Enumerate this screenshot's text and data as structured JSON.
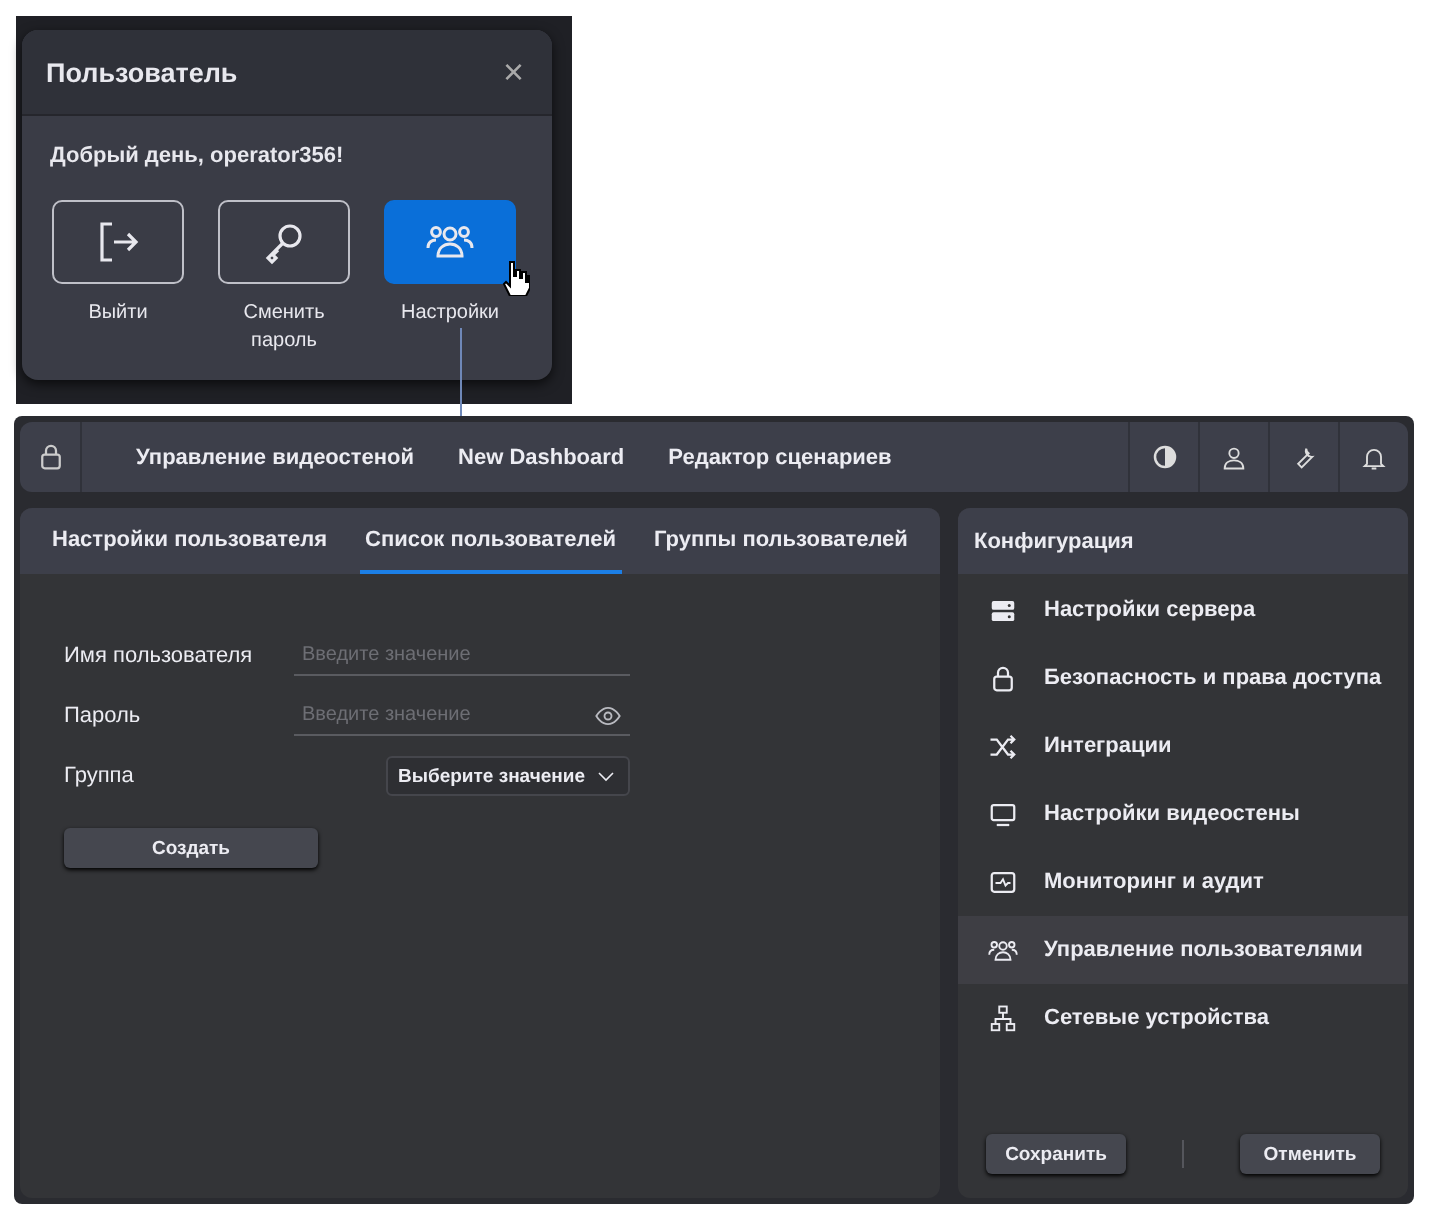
{
  "popup": {
    "title": "Пользователь",
    "close": "×",
    "greeting": "Добрый день, operator356!",
    "actions": [
      {
        "kind": "logout",
        "label": "Выйти",
        "selected": false
      },
      {
        "kind": "key",
        "label": "Сменить пароль",
        "selected": false
      },
      {
        "kind": "users",
        "label": "Настройки",
        "selected": true
      }
    ]
  },
  "top_bar": {
    "nav": [
      "Управление видеостеной",
      "New Dashboard",
      "Редактор сценариев"
    ],
    "icons": [
      {
        "kind": "contrast"
      },
      {
        "kind": "user"
      },
      {
        "kind": "wrench"
      },
      {
        "kind": "bell"
      }
    ]
  },
  "tabs": [
    {
      "label": "Настройки пользователя",
      "selected": false
    },
    {
      "label": "Список пользователей",
      "selected": true
    },
    {
      "label": "Группы пользователей",
      "selected": false
    }
  ],
  "form": {
    "fields": [
      {
        "kind": "text",
        "label": "Имя пользователя",
        "placeholder": "Введите значение"
      },
      {
        "kind": "password",
        "label": "Пароль",
        "placeholder": "Введите значение"
      },
      {
        "kind": "select",
        "label": "Группа",
        "placeholder": "Выберите значение"
      }
    ],
    "submit": "Создать"
  },
  "config": {
    "title": "Конфигурация",
    "items": [
      {
        "kind": "server",
        "label": "Настройки сервера",
        "selected": false
      },
      {
        "kind": "lock",
        "label": "Безопасность и права доступа",
        "selected": false
      },
      {
        "kind": "shuffle",
        "label": "Интеграции",
        "selected": false
      },
      {
        "kind": "monitor",
        "label": "Настройки видеостены",
        "selected": false
      },
      {
        "kind": "pulse",
        "label": "Мониторинг и аудит",
        "selected": false
      },
      {
        "kind": "users",
        "label": "Управление пользователями",
        "selected": true
      },
      {
        "kind": "network",
        "label": "Сетевые устройства",
        "selected": false
      }
    ],
    "buttons": [
      "Сохранить",
      "Отменить"
    ]
  }
}
